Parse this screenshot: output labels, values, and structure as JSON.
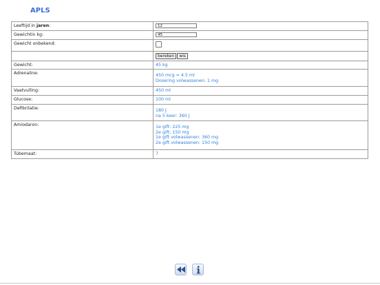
{
  "app": {
    "title": "APLS"
  },
  "form": {
    "age": {
      "label_prefix": "Leeftijd in ",
      "label_bold": "jaren",
      "label_suffix": ":",
      "value": "12"
    },
    "weight_input": {
      "label_line1": "Gewicht",
      "label_line2": "in kg:",
      "value": "45"
    },
    "weight_unknown": {
      "label": "Gewicht onbekend:",
      "checked": false
    },
    "buttons": {
      "calculate": "bereken",
      "clear": "wis"
    }
  },
  "results": [
    {
      "label": "Gewicht:",
      "lines": [
        "45 kg"
      ]
    },
    {
      "label": "Adrenaline:",
      "lines": [
        "450 mcg = 4.5 ml",
        "Dosering volwassenen: 1 mg"
      ]
    },
    {
      "label": "Vaatvulling:",
      "lines": [
        "450 ml"
      ]
    },
    {
      "label": "Glucose:",
      "lines": [
        "100 ml"
      ]
    },
    {
      "label": "Defibrilatie:",
      "lines": [
        "180 J",
        "na 5 keer: 360 J"
      ]
    },
    {
      "label": "Amiodaron:",
      "lines": [
        "1e gift: 225 mg",
        "2e gift: 150 mg",
        "1e gift volwassenen: 360 mg",
        "2e gift volwassenen: 150 mg"
      ]
    },
    {
      "label": "Tubemaat:",
      "lines": [
        "7"
      ]
    }
  ],
  "footer": {
    "back_icon": "rewind-icon",
    "info_icon": "info-icon"
  },
  "colors": {
    "accent": "#2f7fdc",
    "title": "#3b6fd8"
  }
}
